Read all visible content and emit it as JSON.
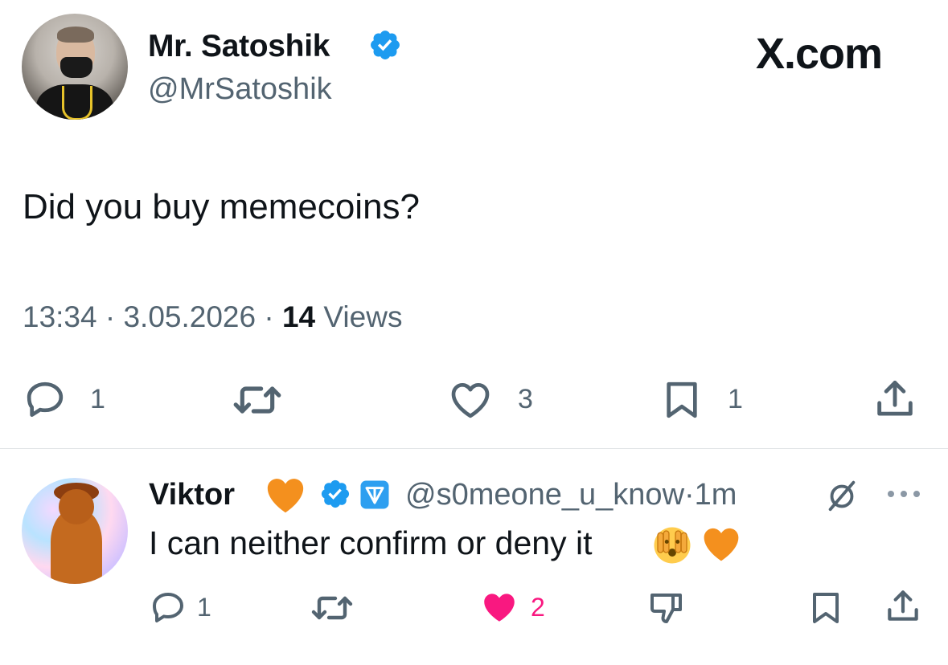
{
  "tweet": {
    "author_name": "Mr. Satoshik",
    "author_handle": "@MrSatoshik",
    "brand": "X.com",
    "text": "Did you buy memecoins?",
    "time": "13:34",
    "date": "3.05.2026",
    "views_count": "14",
    "views_label": "Views",
    "actions": {
      "reply_count": "1",
      "like_count": "3",
      "bookmark_count": "1"
    }
  },
  "reply": {
    "author_name": "Viktor",
    "author_handle": "@s0meone_u_know",
    "time_ago": "1m",
    "text": "I can neither confirm or deny it",
    "actions": {
      "reply_count": "1",
      "like_count": "2"
    }
  },
  "colors": {
    "verified_blue": "#1d9bf0",
    "like_pink": "#f91880",
    "heart_orange": "#f4901e",
    "text_secondary": "#536471"
  },
  "icons": {
    "verified": "verified-badge-icon",
    "reply": "speech-bubble-icon",
    "repost": "repost-arrows-icon",
    "like": "heart-icon",
    "bookmark": "bookmark-icon",
    "share": "share-upload-icon",
    "grok": "grok-slash-circle-icon",
    "more": "ellipsis-icon",
    "dislike": "thumbs-down-icon"
  }
}
